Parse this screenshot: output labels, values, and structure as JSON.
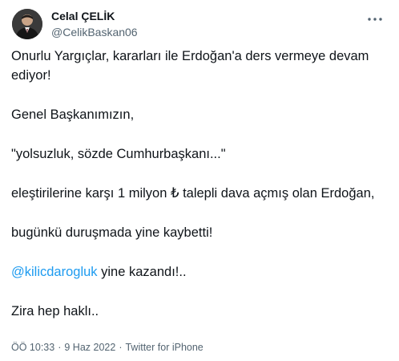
{
  "author": {
    "display_name": "Celal ÇELİK",
    "handle": "@CelikBaskan06"
  },
  "icons": {
    "avatar": "user-avatar",
    "more": "more-horizontal-icon"
  },
  "tweet": {
    "p1": "Onurlu Yargıçlar, kararları ile Erdoğan'a ders vermeye devam ediyor!",
    "p2": "Genel Başkanımızın,",
    "p3": "\"yolsuzluk, sözde Cumhurbaşkanı...\"",
    "p4": "eleştirilerine karşı 1 milyon ₺ talepli dava açmış olan Erdoğan,",
    "p5": "bugünkü duruşmada yine kaybetti!",
    "mention": "@kilicdarogluk",
    "p6_rest": " yine kazandı!..",
    "p7": "Zira hep haklı.."
  },
  "meta": {
    "time": "ÖÖ 10:33",
    "separator": "·",
    "date": "9 Haz 2022",
    "source": "Twitter for iPhone"
  },
  "colors": {
    "text": "#0f1419",
    "secondary": "#536471",
    "link": "#1d9bf0"
  }
}
